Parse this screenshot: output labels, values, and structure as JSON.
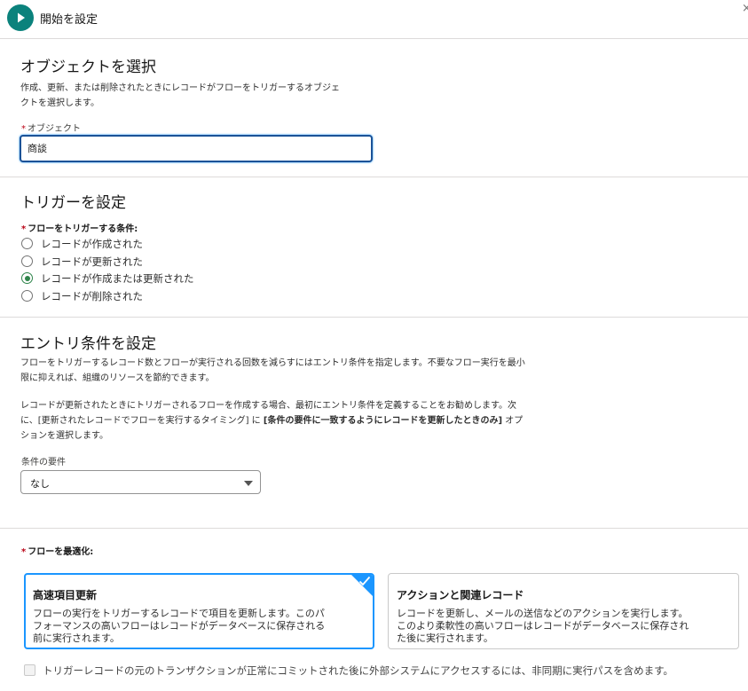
{
  "header": {
    "title": "開始を設定",
    "close_glyph": "×",
    "start_icon": "play-icon",
    "accent_color": "#0b827c"
  },
  "object_section": {
    "heading": "オブジェクトを選択",
    "description_lines": [
      "作成、更新、または削除されたときにレコードがフローをトリガーするオブジェ",
      "クトを選択します。"
    ],
    "field_required_mark": "*",
    "field_label": "オブジェクト",
    "field_value": "商談"
  },
  "trigger_section": {
    "heading": "トリガーを設定",
    "required_mark": "*",
    "label": "フローをトリガーする条件:",
    "options": [
      {
        "label": "レコードが作成された",
        "checked": false
      },
      {
        "label": "レコードが更新された",
        "checked": false
      },
      {
        "label": "レコードが作成または更新された",
        "checked": true
      },
      {
        "label": "レコードが削除された",
        "checked": false
      }
    ]
  },
  "entry_section": {
    "heading": "エントリ条件を設定",
    "paragraph1_lines": [
      "フローをトリガーするレコード数とフローが実行される回数を減らすにはエントリ条件を指定します。不要なフロー実行を最小",
      "限に抑えれば、組織のリソースを節約できます。"
    ],
    "paragraph2_line1": "レコードが更新されたときにトリガーされるフローを作成する場合、最初にエントリ条件を定義することをお勧めします。次",
    "paragraph2_line2_prefix": "に、[更新されたレコードでフローを実行するタイミング] に ",
    "paragraph2_line2_bold": "[条件の要件に一致するようにレコードを更新したときのみ]",
    "paragraph2_line2_suffix": " オプ",
    "paragraph2_line3": "ションを選択します。",
    "condition_label": "条件の要件",
    "condition_value": "なし"
  },
  "optimize_section": {
    "required_mark": "*",
    "label": "フローを最適化:",
    "cards": [
      {
        "title": "高速項目更新",
        "description_lines": [
          "フローの実行をトリガーするレコードで項目を更新します。このパ",
          "フォーマンスの高いフローはレコードがデータベースに保存される",
          "前に実行されます。"
        ],
        "selected": true
      },
      {
        "title": "アクションと関連レコード",
        "description_lines": [
          "レコードを更新し、メールの送信などのアクションを実行します。",
          "このより柔軟性の高いフローはレコードがデータベースに保存され",
          "た後に実行されます。"
        ],
        "selected": false
      }
    ],
    "selected_color": "#1b96ff",
    "async_checkbox_label": "トリガーレコードの元のトランザクションが正常にコミットされた後に外部システムにアクセスするには、非同期に実行パスを含めます。",
    "async_checked": false
  }
}
